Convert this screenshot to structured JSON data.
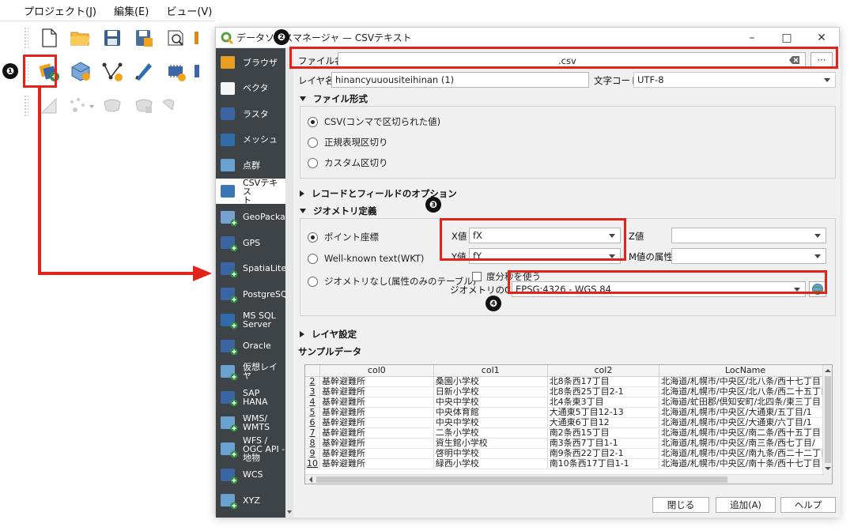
{
  "menubar": [
    "プロジェクト(J)",
    "編集(E)",
    "ビュー(V)"
  ],
  "dialog": {
    "title": "データソースマネージャ — CSVテキスト",
    "window_controls": {
      "minimize": "–",
      "maximize": "□",
      "close": "✕"
    }
  },
  "sidebar": {
    "items": [
      {
        "label": "ブラウザ",
        "icon": "folder-icon"
      },
      {
        "label": "ベクタ",
        "icon": "vector-icon"
      },
      {
        "label": "ラスタ",
        "icon": "raster-icon"
      },
      {
        "label": "メッシュ",
        "icon": "mesh-icon"
      },
      {
        "label": "点群",
        "icon": "pointcloud-icon"
      },
      {
        "label": "CSVテキス\nト",
        "icon": "csv-icon"
      },
      {
        "label": "GeoPackage",
        "icon": "geopackage-icon"
      },
      {
        "label": "GPS",
        "icon": "gps-icon"
      },
      {
        "label": "SpatiaLite",
        "icon": "spatialite-icon"
      },
      {
        "label": "PostgreSQL",
        "icon": "postgresql-icon"
      },
      {
        "label": "MS SQL\nServer",
        "icon": "mssql-icon"
      },
      {
        "label": "Oracle",
        "icon": "oracle-icon"
      },
      {
        "label": "仮想レイヤ",
        "icon": "virtual-layer-icon"
      },
      {
        "label": "SAP\nHANA",
        "icon": "sap-hana-icon"
      },
      {
        "label": "WMS/\nWMTS",
        "icon": "wms-icon"
      },
      {
        "label": "WFS /\nOGC API -\n地物",
        "icon": "wfs-icon"
      },
      {
        "label": "WCS",
        "icon": "wcs-icon"
      },
      {
        "label": "XYZ",
        "icon": "xyz-icon"
      }
    ]
  },
  "file": {
    "label": "ファイル名",
    "value": ".csv",
    "browse_label": "···"
  },
  "layer": {
    "label": "レイヤ名",
    "value": "hinancyuuousiteihinan (1)",
    "encoding_label": "文字コード",
    "encoding_value": "UTF-8"
  },
  "file_format": {
    "header": "ファイル形式",
    "options": [
      "CSV(コンマで区切られた値)",
      "正規表現区切り",
      "カスタム区切り"
    ],
    "selected": 0
  },
  "record_options": {
    "header": "レコードとフィールドのオプション"
  },
  "geometry": {
    "header": "ジオメトリ定義",
    "options": [
      "ポイント座標",
      "Well-known text(WKT)",
      "ジオメトリなし(属性のみのテーブル)"
    ],
    "x_label": "X値",
    "x_value": "fX",
    "y_label": "Y値",
    "y_value": "fY",
    "z_label": "Z値",
    "z_value": "",
    "m_label": "M値の属性",
    "m_value": "",
    "dms_label": "度分秒を使う",
    "crs_label": "ジオメトリのCRS",
    "crs_value": "EPSG:4326 - WGS 84"
  },
  "layer_settings": {
    "header": "レイヤ設定"
  },
  "sample": {
    "header": "サンプルデータ",
    "columns": [
      "col0",
      "col1",
      "col2",
      "LocName"
    ],
    "rows": [
      [
        "2",
        "基幹避難所",
        "桑園小学校",
        "北8条西17丁目",
        "北海道/札幌市/中央区/北八条/西十七丁目"
      ],
      [
        "3",
        "基幹避難所",
        "日新小学校",
        "北8条西25丁目2-1",
        "北海道/札幌市/中央区/北八条/西二十五丁目"
      ],
      [
        "4",
        "基幹避難所",
        "中央中学校",
        "北4条東3丁目",
        "北海道/虻田郡/倶知安町/北四条/東三丁目"
      ],
      [
        "5",
        "基幹避難所",
        "中央体育館",
        "大通東5丁目12-13",
        "北海道/札幌市/中央区/大通東/五丁目/1"
      ],
      [
        "6",
        "基幹避難所",
        "中央中学校",
        "大通東6丁目12",
        "北海道/札幌市/中央区/大通東/六丁目/1"
      ],
      [
        "7",
        "基幹避難所",
        "二条小学校",
        "南2条西15丁目",
        "北海道/札幌市/中央区/南二条/西十五丁目"
      ],
      [
        "8",
        "基幹避難所",
        "資生館小学校",
        "南3条西7丁目1-1",
        "北海道/札幌市/中央区/南三条/西七丁目/"
      ],
      [
        "9",
        "基幹避難所",
        "啓明中学校",
        "南9条西22丁目2-1",
        "北海道/札幌市/中央区/南九条/西二十二丁目"
      ],
      [
        "10",
        "基幹避難所",
        "緑西小学校",
        "南10条西17丁目1-1",
        "北海道/札幌市/中央区/南十条/西十七丁目"
      ]
    ]
  },
  "buttons": {
    "close": "閉じる",
    "add": "追加(A)",
    "help": "ヘルプ"
  },
  "annotations": [
    "❶",
    "❷",
    "❸",
    "❹"
  ],
  "colors": {
    "highlight": "#e2231a",
    "sidebar_bg": "#3e4347",
    "accent": "#f2a31b"
  }
}
